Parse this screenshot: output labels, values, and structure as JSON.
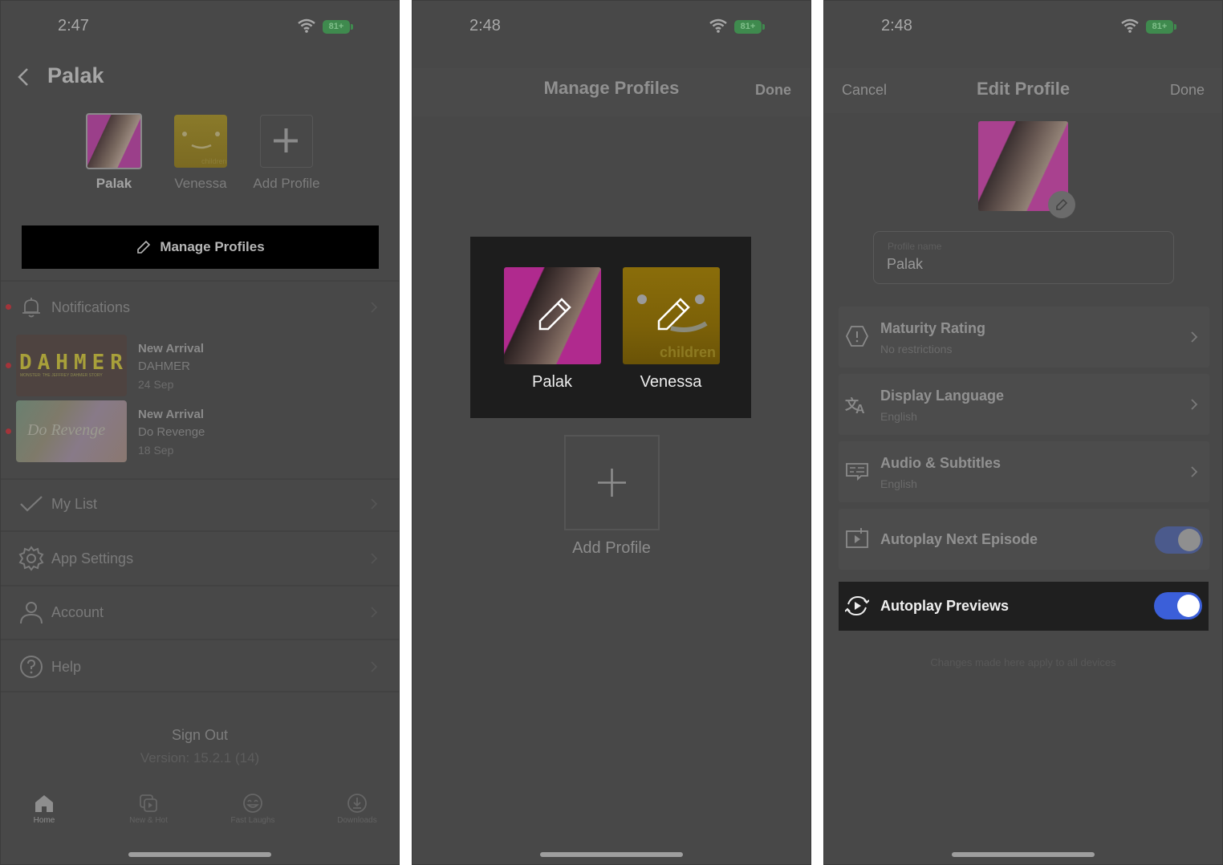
{
  "panel1": {
    "status": {
      "time": "2:47",
      "battery": "81+"
    },
    "title": "Palak",
    "profiles": [
      {
        "name": "Palak",
        "selected": true,
        "kind": "photo"
      },
      {
        "name": "Venessa",
        "selected": false,
        "kind": "children",
        "badge": "children"
      },
      {
        "name": "Add Profile",
        "kind": "add"
      }
    ],
    "manage_button": "Manage Profiles",
    "notifications": {
      "label": "Notifications",
      "items": [
        {
          "title": "New Arrival",
          "show": "DAHMER",
          "date": "24 Sep",
          "poster_title": "DAHMER",
          "poster_subtitle": "MONSTER: THE JEFFREY DAHMER STORY"
        },
        {
          "title": "New Arrival",
          "show": "Do Revenge",
          "date": "18 Sep",
          "poster_title": "Do Revenge"
        }
      ]
    },
    "menu": [
      {
        "label": "My List",
        "icon": "check-icon"
      },
      {
        "label": "App Settings",
        "icon": "gear-icon"
      },
      {
        "label": "Account",
        "icon": "person-icon"
      },
      {
        "label": "Help",
        "icon": "help-icon"
      }
    ],
    "sign_out": "Sign Out",
    "version": "Version: 15.2.1 (14)",
    "tabs": [
      {
        "label": "Home",
        "icon": "home-icon",
        "active": true
      },
      {
        "label": "New & Hot",
        "icon": "new-hot-icon"
      },
      {
        "label": "Fast Laughs",
        "icon": "fast-laughs-icon"
      },
      {
        "label": "Downloads",
        "icon": "downloads-icon"
      }
    ]
  },
  "panel2": {
    "status": {
      "time": "2:48",
      "battery": "81+"
    },
    "title": "Manage Profiles",
    "done": "Done",
    "profiles": [
      {
        "name": "Palak"
      },
      {
        "name": "Venessa",
        "badge": "children"
      }
    ],
    "add_profile": "Add Profile"
  },
  "panel3": {
    "status": {
      "time": "2:48",
      "battery": "81+"
    },
    "cancel": "Cancel",
    "title": "Edit Profile",
    "done": "Done",
    "name_field": {
      "label": "Profile name",
      "value": "Palak"
    },
    "settings": [
      {
        "title": "Maturity Rating",
        "value": "No restrictions",
        "icon": "maturity-icon"
      },
      {
        "title": "Display Language",
        "value": "English",
        "icon": "language-icon"
      },
      {
        "title": "Audio & Subtitles",
        "value": "English",
        "icon": "subtitles-icon"
      }
    ],
    "toggles": [
      {
        "title": "Autoplay Next Episode",
        "on": true,
        "icon": "autoplay-next-icon"
      },
      {
        "title": "Autoplay Previews",
        "on": true,
        "icon": "autoplay-previews-icon",
        "highlighted": true
      }
    ],
    "footnote": "Changes made here apply to all devices",
    "colors": {
      "toggle_on": "#3b5fd9",
      "toggle_dim": "#4b5a8c"
    }
  }
}
